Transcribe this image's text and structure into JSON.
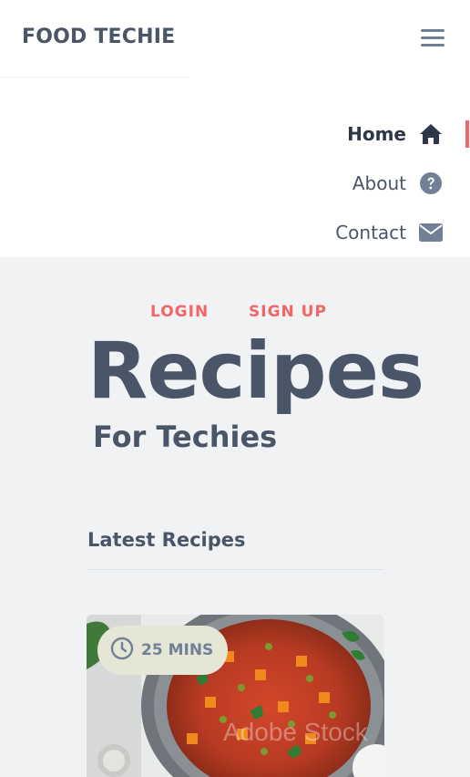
{
  "header": {
    "brand": "FOOD TECHIE",
    "menu_icon": "hamburger-icon"
  },
  "nav": {
    "items": [
      {
        "label": "Home",
        "icon": "home-icon",
        "active": true
      },
      {
        "label": "About",
        "icon": "question-circle-icon",
        "active": false
      },
      {
        "label": "Contact",
        "icon": "envelope-icon",
        "active": false
      }
    ]
  },
  "hero": {
    "login": "LOGIN",
    "signup": "SIGN UP",
    "title": "Recipes",
    "subtitle": "For Techies"
  },
  "latest": {
    "heading": "Latest Recipes",
    "cards": [
      {
        "time": "25 MINS",
        "time_icon": "clock-icon",
        "watermark": "Adobe Stock"
      }
    ]
  },
  "colors": {
    "accent": "#f56565",
    "text": "#4a5568",
    "hero_bg": "#f1f2f4"
  }
}
